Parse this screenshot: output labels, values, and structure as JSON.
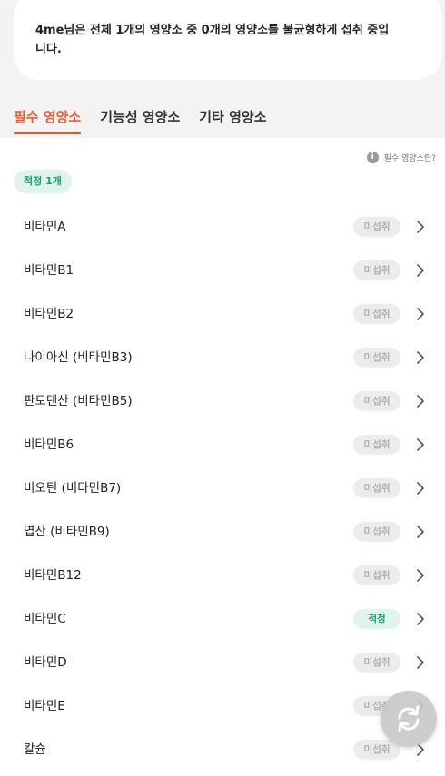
{
  "summary": {
    "text": "4me님은 전체 1개의 영양소 중 0개의 영양소를 불균형하게 섭취 중입니다."
  },
  "tabs": [
    {
      "label": "필수 영양소",
      "active": true
    },
    {
      "label": "기능성 영양소",
      "active": false
    },
    {
      "label": "기타 영양소",
      "active": false
    }
  ],
  "help": {
    "label": "필수 영양소란?",
    "icon": "info-icon"
  },
  "group": {
    "label": "적정 1개"
  },
  "nutrients": [
    {
      "name": "비타민A",
      "status": "미섭취",
      "type": "none"
    },
    {
      "name": "비타민B1",
      "status": "미섭취",
      "type": "none"
    },
    {
      "name": "비타민B2",
      "status": "미섭취",
      "type": "none"
    },
    {
      "name": "나이아신 (비타민B3)",
      "status": "미섭취",
      "type": "none"
    },
    {
      "name": "판토텐산 (비타민B5)",
      "status": "미섭취",
      "type": "none"
    },
    {
      "name": "비타민B6",
      "status": "미섭취",
      "type": "none"
    },
    {
      "name": "비오틴 (비타민B7)",
      "status": "미섭취",
      "type": "none"
    },
    {
      "name": "엽산 (비타민B9)",
      "status": "미섭취",
      "type": "none"
    },
    {
      "name": "비타민B12",
      "status": "미섭취",
      "type": "none"
    },
    {
      "name": "비타민C",
      "status": "적정",
      "type": "ok"
    },
    {
      "name": "비타민D",
      "status": "미섭취",
      "type": "none"
    },
    {
      "name": "비타민E",
      "status": "미섭취",
      "type": "none"
    },
    {
      "name": "칼슘",
      "status": "미섭취",
      "type": "none"
    }
  ],
  "fab": {
    "icon": "refresh-icon"
  },
  "colors": {
    "accent": "#ee5b30",
    "ok_bg": "#dff5ec",
    "ok_text": "#16a070",
    "none_bg": "#ececec",
    "none_text": "#b1b1b1"
  }
}
